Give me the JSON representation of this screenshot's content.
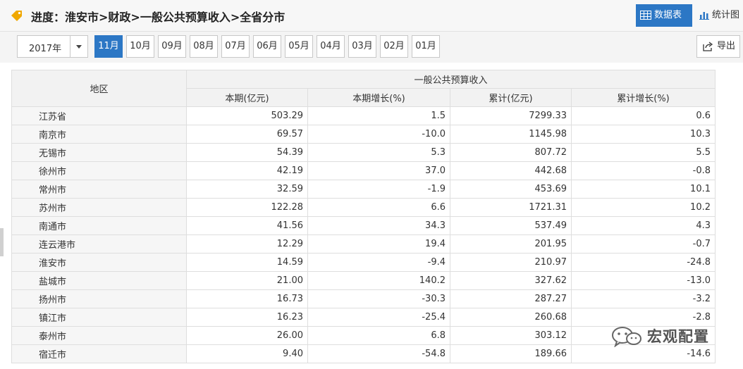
{
  "header": {
    "title": "进度：淮安市>财政>一般公共预算收入>全省分市",
    "views": [
      {
        "label": "数据表",
        "icon": "table-icon",
        "active": true
      },
      {
        "label": "统计图",
        "icon": "bar-chart-icon",
        "active": false
      }
    ]
  },
  "toolbar": {
    "year": "2017年",
    "months": [
      "11月",
      "10月",
      "09月",
      "08月",
      "07月",
      "06月",
      "05月",
      "04月",
      "03月",
      "02月",
      "01月"
    ],
    "active_month": "11月",
    "export_label": "导出"
  },
  "table": {
    "region_header": "地区",
    "group_header": "一般公共预算收入",
    "columns": [
      "本期(亿元)",
      "本期增长(%)",
      "累计(亿元)",
      "累计增长(%)"
    ],
    "rows": [
      {
        "name": "江苏省",
        "values": [
          "503.29",
          "1.5",
          "7299.33",
          "0.6"
        ]
      },
      {
        "name": "南京市",
        "values": [
          "69.57",
          "-10.0",
          "1145.98",
          "10.3"
        ]
      },
      {
        "name": "无锡市",
        "values": [
          "54.39",
          "5.3",
          "807.72",
          "5.5"
        ]
      },
      {
        "name": "徐州市",
        "values": [
          "42.19",
          "37.0",
          "442.68",
          "-0.8"
        ]
      },
      {
        "name": "常州市",
        "values": [
          "32.59",
          "-1.9",
          "453.69",
          "10.1"
        ]
      },
      {
        "name": "苏州市",
        "values": [
          "122.28",
          "6.6",
          "1721.31",
          "10.2"
        ]
      },
      {
        "name": "南通市",
        "values": [
          "41.56",
          "34.3",
          "537.49",
          "4.3"
        ]
      },
      {
        "name": "连云港市",
        "values": [
          "12.29",
          "19.4",
          "201.95",
          "-0.7"
        ]
      },
      {
        "name": "淮安市",
        "values": [
          "14.59",
          "-9.4",
          "210.97",
          "-24.8"
        ]
      },
      {
        "name": "盐城市",
        "values": [
          "21.00",
          "140.2",
          "327.62",
          "-13.0"
        ]
      },
      {
        "name": "扬州市",
        "values": [
          "16.73",
          "-30.3",
          "287.27",
          "-3.2"
        ]
      },
      {
        "name": "镇江市",
        "values": [
          "16.23",
          "-25.4",
          "260.68",
          "-2.8"
        ]
      },
      {
        "name": "泰州市",
        "values": [
          "26.00",
          "6.8",
          "303.12",
          ""
        ]
      },
      {
        "name": "宿迁市",
        "values": [
          "9.40",
          "-54.8",
          "189.66",
          "-14.6"
        ]
      }
    ]
  },
  "watermark": {
    "text": "宏观配置",
    "icon": "wechat-icon"
  },
  "colors": {
    "accent": "#2c77c5",
    "tag": "#f0a800"
  }
}
